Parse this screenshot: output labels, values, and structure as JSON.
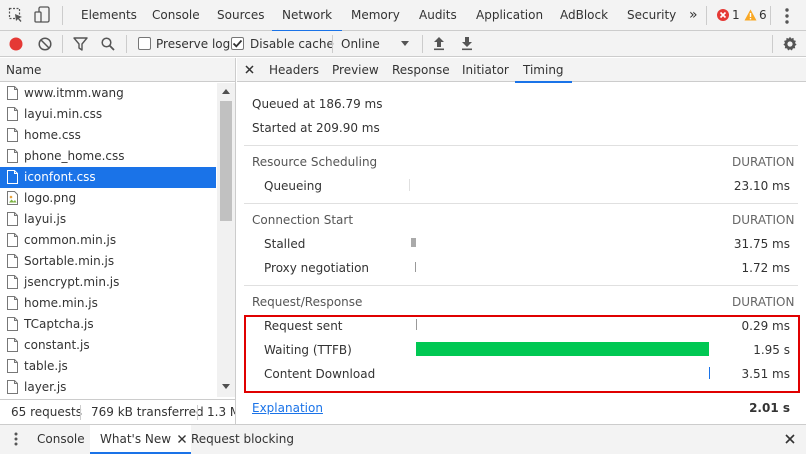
{
  "topbar": {
    "tabs": [
      "Elements",
      "Console",
      "Sources",
      "Network",
      "Memory",
      "Audits",
      "Application",
      "AdBlock",
      "Security"
    ],
    "active_tab": "Network",
    "more_label": "»",
    "error_count": "1",
    "warning_count": "6"
  },
  "toolbar": {
    "preserve_log_label": "Preserve log",
    "preserve_log_checked": false,
    "disable_cache_label": "Disable cache",
    "disable_cache_checked": true,
    "throttle_value": "Online"
  },
  "requests": {
    "column_header": "Name",
    "items": [
      {
        "name": "www.itmm.wang",
        "selected": false,
        "icon": "document-icon"
      },
      {
        "name": "layui.min.css",
        "selected": false,
        "icon": "document-icon"
      },
      {
        "name": "home.css",
        "selected": false,
        "icon": "document-icon"
      },
      {
        "name": "phone_home.css",
        "selected": false,
        "icon": "document-icon"
      },
      {
        "name": "iconfont.css",
        "selected": true,
        "icon": "document-icon"
      },
      {
        "name": "logo.png",
        "selected": false,
        "icon": "image-icon"
      },
      {
        "name": "layui.js",
        "selected": false,
        "icon": "document-icon"
      },
      {
        "name": "common.min.js",
        "selected": false,
        "icon": "document-icon"
      },
      {
        "name": "Sortable.min.js",
        "selected": false,
        "icon": "document-icon"
      },
      {
        "name": "jsencrypt.min.js",
        "selected": false,
        "icon": "document-icon"
      },
      {
        "name": "home.min.js",
        "selected": false,
        "icon": "document-icon"
      },
      {
        "name": "TCaptcha.js",
        "selected": false,
        "icon": "document-icon"
      },
      {
        "name": "constant.js",
        "selected": false,
        "icon": "document-icon"
      },
      {
        "name": "table.js",
        "selected": false,
        "icon": "document-icon"
      },
      {
        "name": "layer.js",
        "selected": false,
        "icon": "document-icon"
      }
    ],
    "status": {
      "requests": "65 requests",
      "transferred": "769 kB transferred",
      "resources": "1.3 M"
    }
  },
  "detail": {
    "tabs": [
      "Headers",
      "Preview",
      "Response",
      "Initiator",
      "Timing"
    ],
    "active_tab": "Timing",
    "queued_at": "Queued at 186.79 ms",
    "started_at": "Started at 209.90 ms",
    "duration_label": "DURATION",
    "sections": [
      {
        "title": "Resource Scheduling",
        "rows": [
          {
            "label": "Queueing",
            "value": "23.10 ms"
          }
        ]
      },
      {
        "title": "Connection Start",
        "rows": [
          {
            "label": "Stalled",
            "value": "31.75 ms"
          },
          {
            "label": "Proxy negotiation",
            "value": "1.72 ms"
          }
        ]
      },
      {
        "title": "Request/Response",
        "rows": [
          {
            "label": "Request sent",
            "value": "0.29 ms"
          },
          {
            "label": "Waiting (TTFB)",
            "value": "1.95 s"
          },
          {
            "label": "Content Download",
            "value": "3.51 ms"
          }
        ]
      }
    ],
    "explanation_label": "Explanation",
    "total": "2.01 s",
    "colors": {
      "waiting_bar": "#00c853",
      "highlight_border": "#e00000",
      "accent": "#1a73e8"
    }
  },
  "drawer": {
    "tabs": [
      "Console",
      "What's New",
      "Request blocking"
    ],
    "active_tab": "What's New"
  }
}
